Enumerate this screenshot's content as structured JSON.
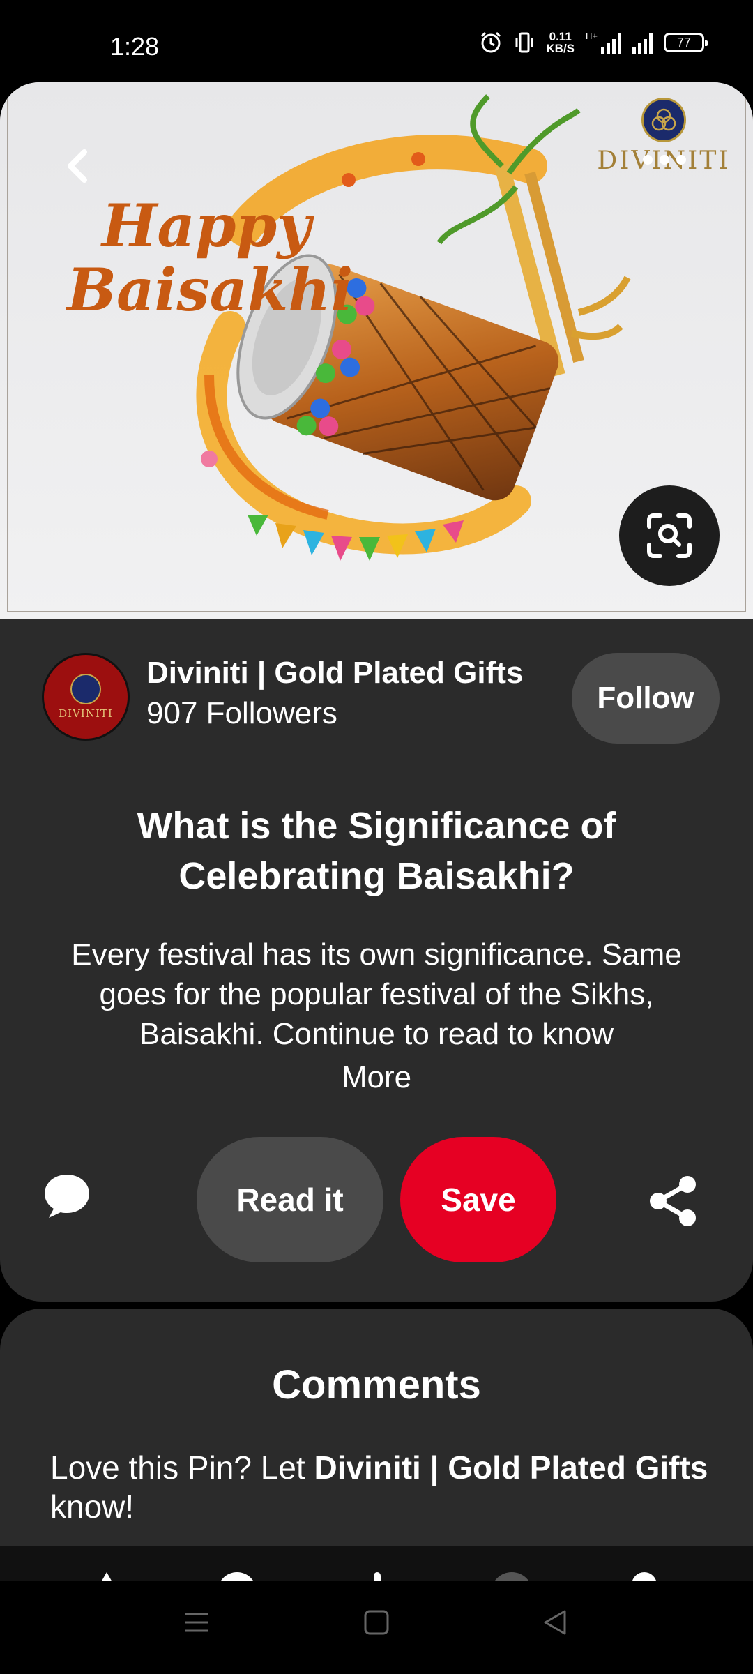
{
  "status_bar": {
    "time": "1:28",
    "speed_value": "0.11",
    "speed_unit": "KB/S",
    "network": "H+",
    "battery": "77"
  },
  "hero": {
    "image_text_line1": "Happy",
    "image_text_line2": "Baisakhi",
    "brand_logo_text": "DIVINITI"
  },
  "creator": {
    "name": "Diviniti | Gold Plated Gifts",
    "followers": "907 Followers",
    "avatar_text": "DIVINITI",
    "follow_label": "Follow"
  },
  "pin": {
    "title": "What is the Significance of Celebrating Baisakhi?",
    "description": "Every festival has its own significance. Same goes for the popular festival of the Sikhs, Baisakhi. Continue to read to know",
    "more_label": "More",
    "read_label": "Read it",
    "save_label": "Save"
  },
  "comments": {
    "title": "Comments",
    "prompt_prefix": "Love this Pin? Let ",
    "prompt_name": "Diviniti | Gold Plated Gifts",
    "prompt_suffix": "know!"
  },
  "icons": [
    "back-icon",
    "more-icon",
    "visual-search-icon",
    "comment-icon",
    "share-icon",
    "menu-icon",
    "home-icon",
    "back-nav-icon"
  ],
  "colors": {
    "save": "#e60023",
    "card": "#2b2b2b",
    "button": "#4a4a4a"
  }
}
